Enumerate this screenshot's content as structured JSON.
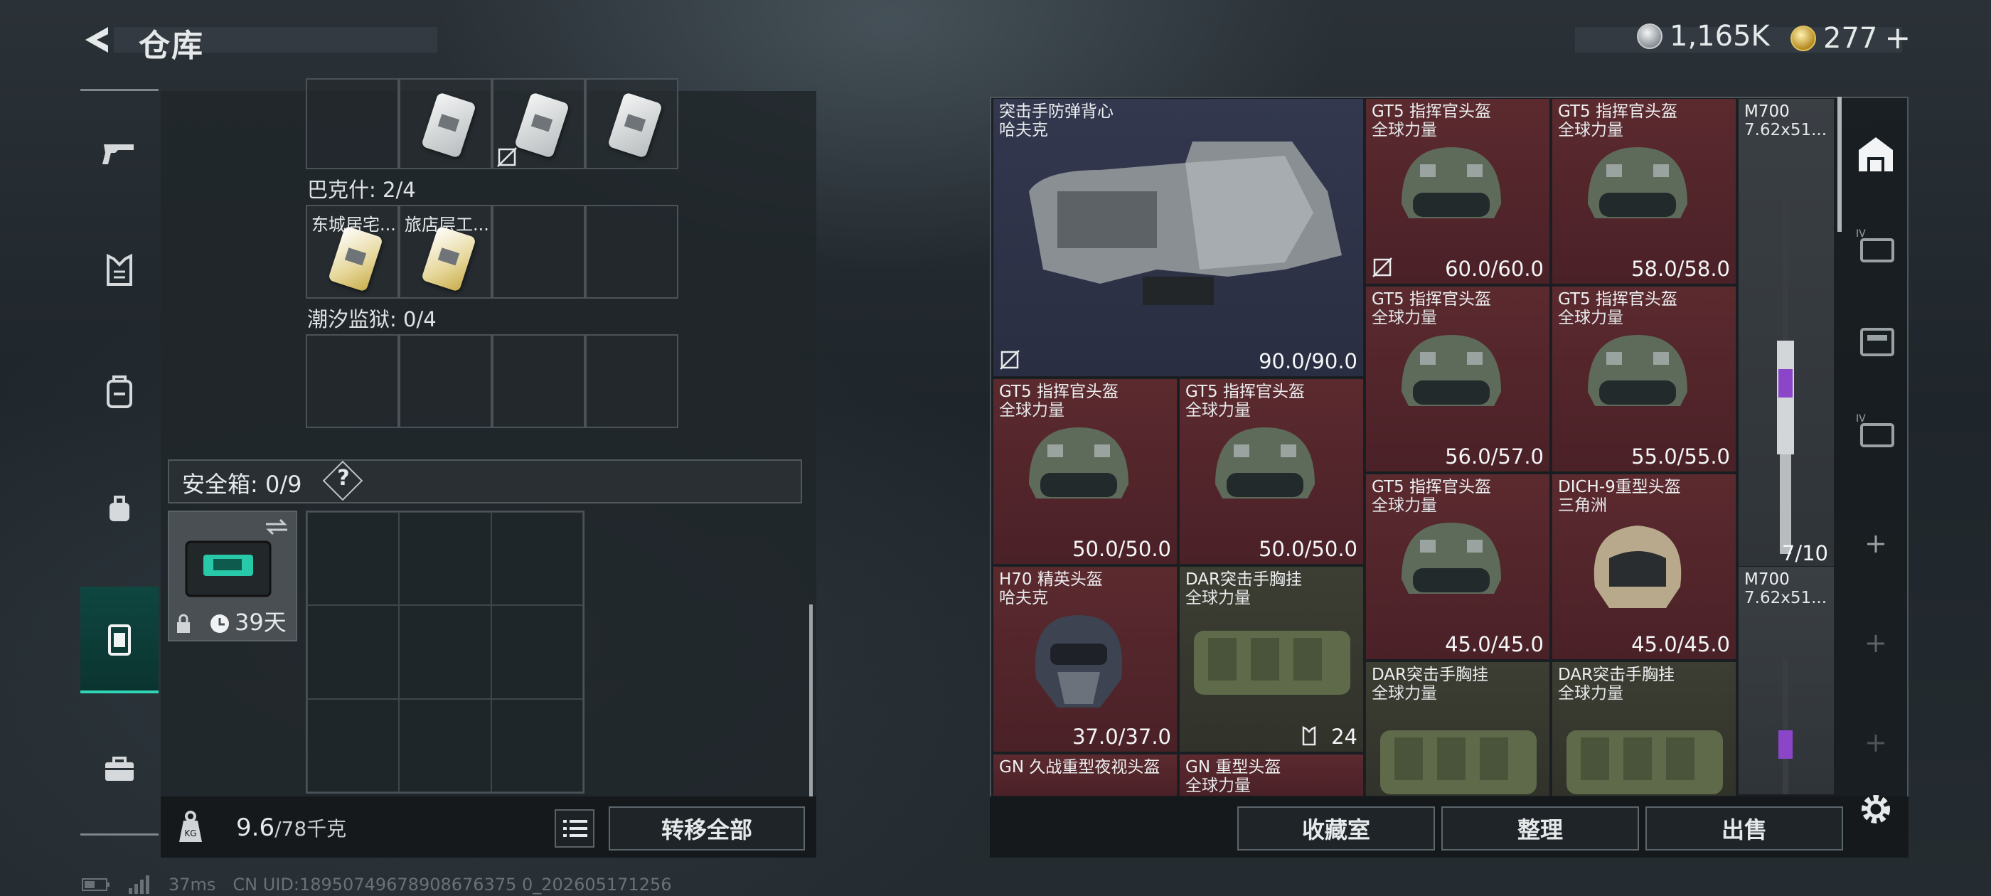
{
  "header": {
    "title": "仓库"
  },
  "currency": {
    "silver": "1,165K",
    "gold": "277",
    "gold_plus": "+"
  },
  "sidebar": {
    "items": [
      "weapons",
      "armor",
      "backpack",
      "rig",
      "container",
      "toolbox"
    ]
  },
  "left": {
    "row1_labels": [
      "",
      "",
      "",
      ""
    ],
    "section_bakeshi": "巴克什: 2/4",
    "bakeshi_keys": [
      "东城居宅...",
      "旅店层工..."
    ],
    "section_chaoxi": "潮汐监狱: 0/4",
    "safe_label": "安全箱: 0/9",
    "help": "?",
    "safebox_timer": "39天",
    "weight": "9.6",
    "weight_cap": "/78千克",
    "transfer_all": "转移全部"
  },
  "warehouse": {
    "items": [
      {
        "name": "突击手防弹背心",
        "sub": "哈夫克",
        "value": "90.0/90.0",
        "color": "blue"
      },
      {
        "name": "GT5 指挥官头盔",
        "sub": "全球力量",
        "value": "60.0/60.0",
        "color": "red"
      },
      {
        "name": "GT5 指挥官头盔",
        "sub": "全球力量",
        "value": "58.0/58.0",
        "color": "red"
      },
      {
        "name": "M700",
        "sub": "7.62x51...",
        "value": "7/10",
        "color": "gray"
      },
      {
        "name": "GT5 指挥官头盔",
        "sub": "全球力量",
        "value": "56.0/57.0",
        "color": "red"
      },
      {
        "name": "GT5 指挥官头盔",
        "sub": "全球力量",
        "value": "55.0/55.0",
        "color": "red"
      },
      {
        "name": "GT5 指挥官头盔",
        "sub": "全球力量",
        "value": "50.0/50.0",
        "color": "red"
      },
      {
        "name": "GT5 指挥官头盔",
        "sub": "全球力量",
        "value": "50.0/50.0",
        "color": "red"
      },
      {
        "name": "GT5 指挥官头盔",
        "sub": "全球力量",
        "value": "45.0/45.0",
        "color": "red"
      },
      {
        "name": "DICH-9重型头盔",
        "sub": "三角洲",
        "value": "45.0/45.0",
        "color": "red"
      },
      {
        "name": "H70 精英头盔",
        "sub": "哈夫克",
        "value": "37.0/37.0",
        "color": "red"
      },
      {
        "name": "DAR突击手胸挂",
        "sub": "全球力量",
        "value": "24",
        "color": "green"
      },
      {
        "name": "M700",
        "sub": "7.62x51...",
        "value": "",
        "color": "gray"
      },
      {
        "name": "DAR突击手胸挂",
        "sub": "全球力量",
        "value": "",
        "color": "green"
      },
      {
        "name": "DAR突击手胸挂",
        "sub": "全球力量",
        "value": "",
        "color": "green"
      },
      {
        "name": "GN 久战重型夜视头盔",
        "sub": "",
        "value": "",
        "color": "red"
      },
      {
        "name": "GN 重型头盔",
        "sub": "全球力量",
        "value": "",
        "color": "red"
      }
    ],
    "btn_collection": "收藏室",
    "btn_sort": "整理",
    "btn_sell": "出售"
  },
  "footer": {
    "ping": "37ms",
    "uid": "CN UID:18950749678908676375 0_202605171256"
  }
}
